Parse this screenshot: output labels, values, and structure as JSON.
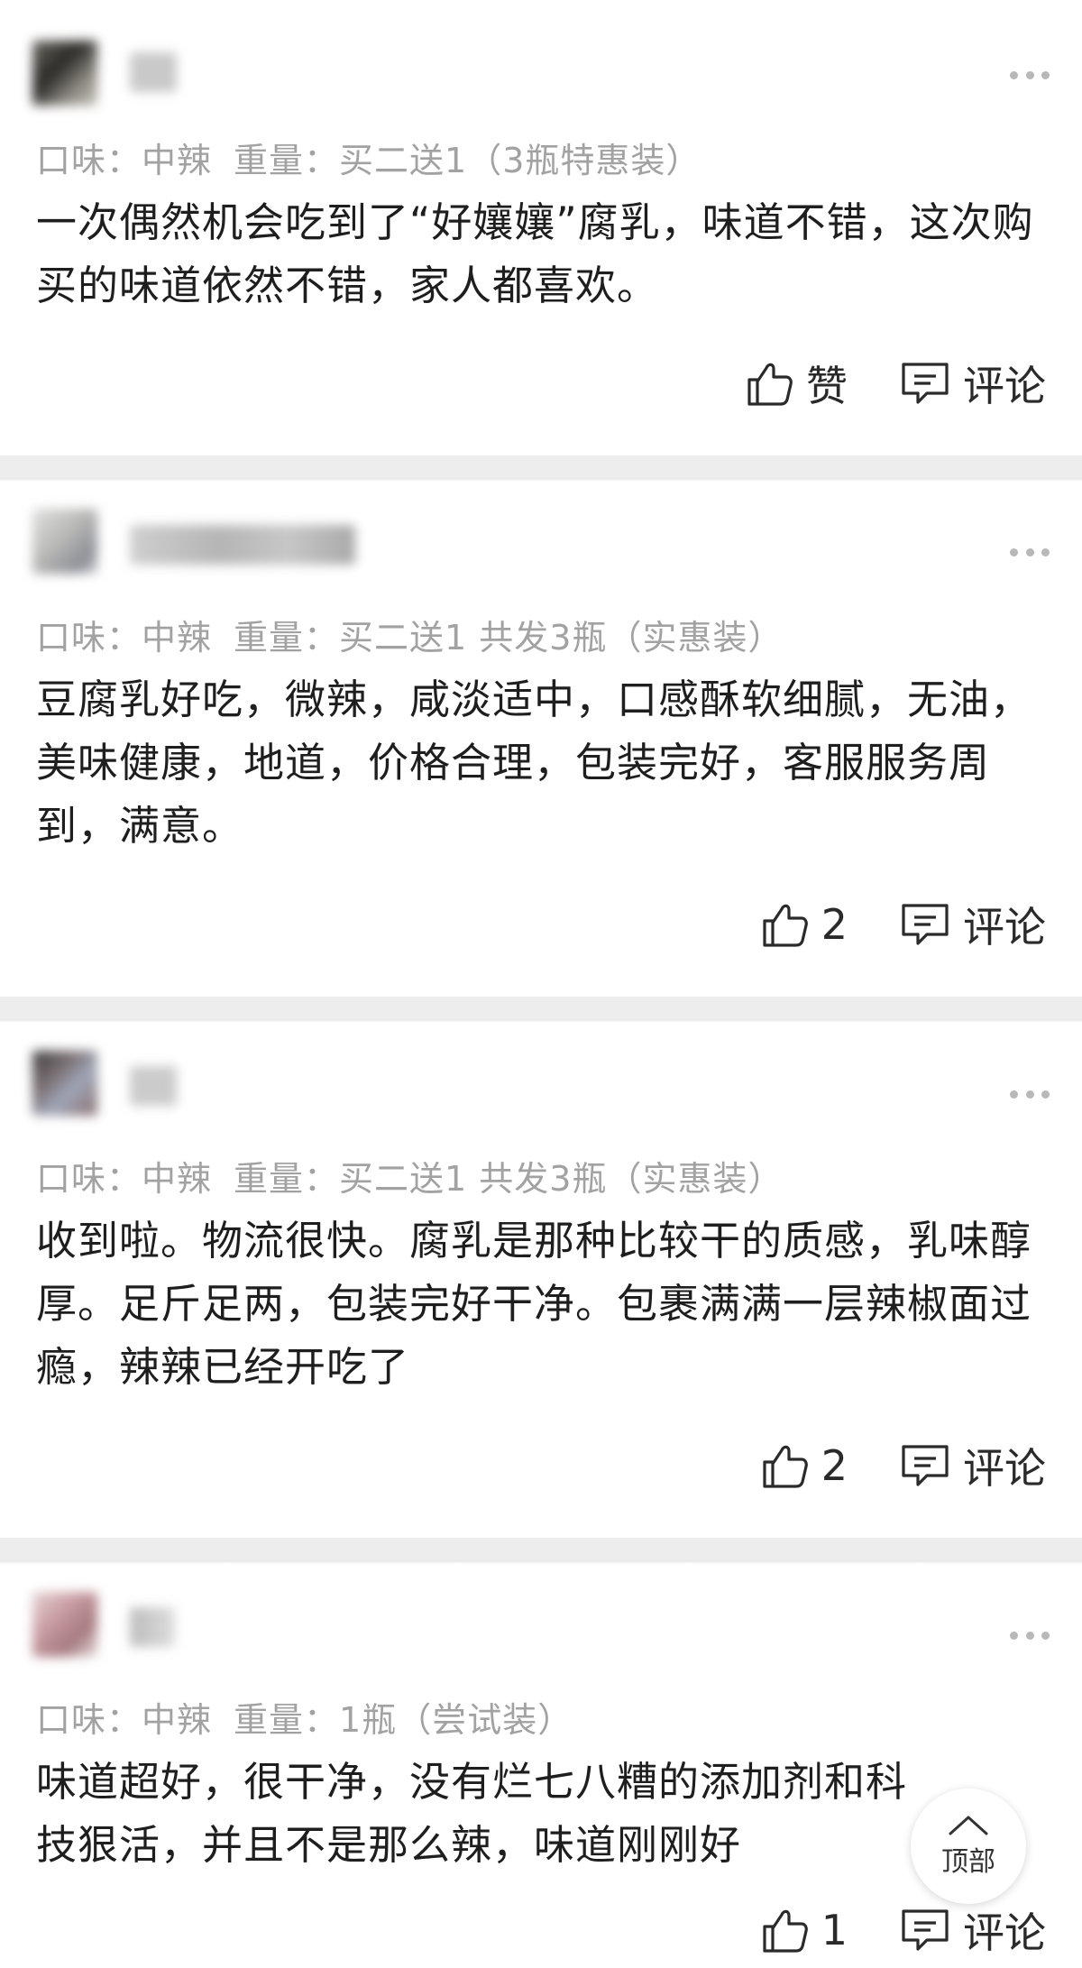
{
  "reviews": [
    {
      "flavor": "口味：中辣",
      "weight": "重量：买二送1（3瓶特惠装）",
      "text": "一次偶然机会吃到了“好孃孃”腐乳，味道不错，这次购买的味道依然不错，家人都喜欢。",
      "like_label": "赞",
      "comment_label": "评论"
    },
    {
      "flavor": "口味：中辣",
      "weight": "重量：买二送1 共发3瓶（实惠装）",
      "text": "豆腐乳好吃，微辣，咸淡适中，口感酥软细腻，无油，美味健康，地道，价格合理，包装完好，客服服务周到，满意。",
      "like_label": "2",
      "comment_label": "评论"
    },
    {
      "flavor": "口味：中辣",
      "weight": "重量：买二送1 共发3瓶（实惠装）",
      "text": "收到啦。物流很快。腐乳是那种比较干的质感，乳味醇厚。足斤足两，包装完好干净。包裹满满一层辣椒面过瘾，辣辣已经开吃了",
      "like_label": "2",
      "comment_label": "评论"
    },
    {
      "flavor": "口味：中辣",
      "weight": "重量：1瓶（尝试装）",
      "text": "味道超好，很干净，没有烂七八糟的添加剂和科技狠活，并且不是那么辣，味道刚刚好",
      "like_label": "1",
      "comment_label": "评论"
    }
  ],
  "back_to_top": {
    "label": "顶部",
    "icon": "chevron-up-icon"
  },
  "icons": {
    "like": "thumbs-up-icon",
    "comment": "comment-icon",
    "more": "more-dots-icon"
  },
  "colors": {
    "page_bg": "#ededed",
    "card_bg": "#ffffff",
    "spec_text": "#a2a2a2",
    "body_text": "#1e1e1e"
  }
}
